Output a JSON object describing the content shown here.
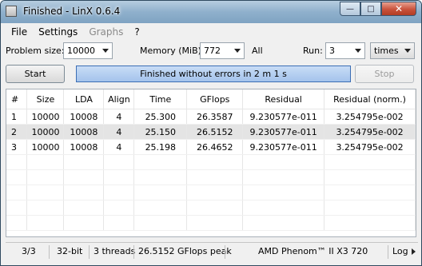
{
  "window": {
    "title": "Finished - LinX 0.6.4"
  },
  "window_buttons": {
    "minimize": "—",
    "maximize": "□",
    "close": "✕"
  },
  "menu": [
    "File",
    "Settings",
    "Graphs",
    "?"
  ],
  "controls": {
    "problem_size_label": "Problem size:",
    "problem_size_value": "10000",
    "memory_label": "Memory (MiB):",
    "memory_value": "772",
    "all_label": "All",
    "run_label": "Run:",
    "run_value": "3",
    "times_value": "times"
  },
  "actions": {
    "start_label": "Start",
    "status_text": "Finished without errors in 2 m 1 s",
    "stop_label": "Stop"
  },
  "table": {
    "columns": [
      "#",
      "Size",
      "LDA",
      "Align",
      "Time",
      "GFlops",
      "Residual",
      "Residual (norm.)"
    ],
    "rows": [
      [
        "1",
        "10000",
        "10008",
        "4",
        "25.300",
        "26.3587",
        "9.230577e-011",
        "3.254795e-002"
      ],
      [
        "2",
        "10000",
        "10008",
        "4",
        "25.150",
        "26.5152",
        "9.230577e-011",
        "3.254795e-002"
      ],
      [
        "3",
        "10000",
        "10008",
        "4",
        "25.198",
        "26.4652",
        "9.230577e-011",
        "3.254795e-002"
      ]
    ],
    "selected_row": 2
  },
  "statusbar": {
    "progress": "3/3",
    "bits": "32-bit",
    "threads": "3 threads",
    "peak": "26.5152 GFlops peak",
    "cpu": "AMD Phenom™ II X3 720",
    "log": "Log"
  }
}
